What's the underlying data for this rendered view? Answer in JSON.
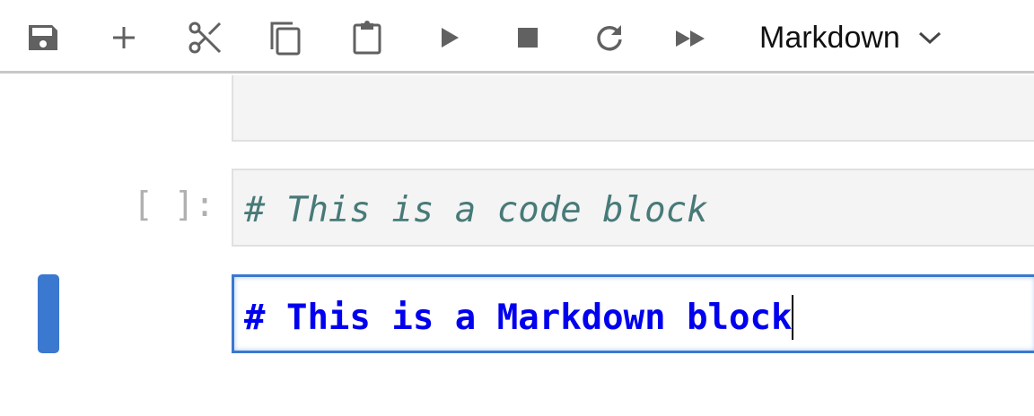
{
  "toolbar": {
    "buttons": [
      "save-icon",
      "plus-icon",
      "scissors-icon",
      "copy-icon",
      "paste-icon",
      "play-icon",
      "stop-icon",
      "restart-icon",
      "fast-forward-icon"
    ],
    "cell_type": "Markdown"
  },
  "cells": [
    {
      "type": "code",
      "prompt": "",
      "source": ""
    },
    {
      "type": "code",
      "prompt": "[ ]:",
      "source": "# This is a code block"
    },
    {
      "type": "markdown",
      "source": "# This is a Markdown block",
      "active": true
    }
  ],
  "colors": {
    "accent": "#3b78cf",
    "comment": "#477a78",
    "markdown_heading": "#0000ee"
  }
}
